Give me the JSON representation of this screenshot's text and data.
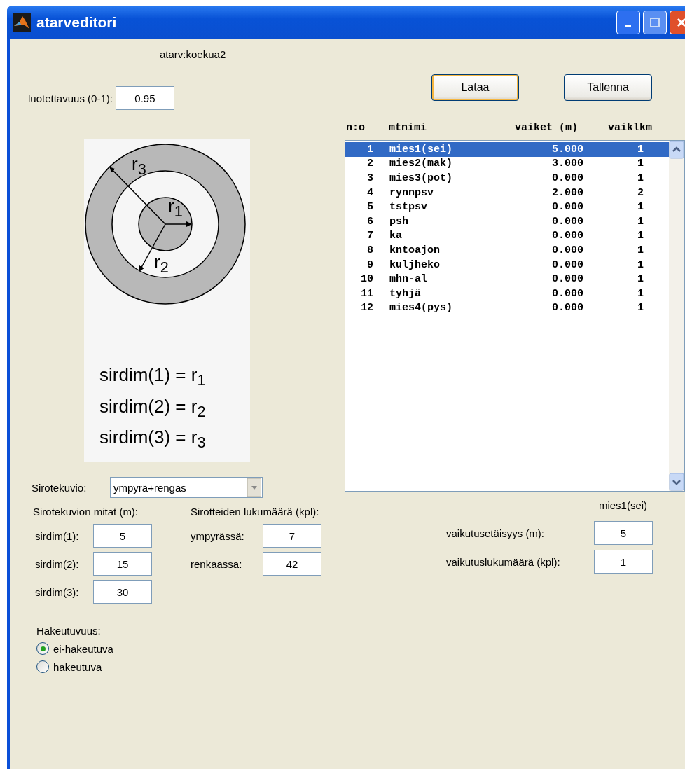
{
  "window": {
    "title": "atarveditori"
  },
  "file_label": "atarv:koekua2",
  "buttons": [
    {
      "label": "Lataa",
      "focused": true
    },
    {
      "label": "Tallenna",
      "focused": false
    }
  ],
  "reliability": {
    "label": "luotettavuus (0-1):",
    "value": "0.95"
  },
  "diagram": {
    "radius_labels": [
      "r$_{3}$",
      "r$_{1}$",
      "r$_{2}$"
    ],
    "equations": [
      "sirdim(1) = r$_{1}$",
      "sirdim(2) = r$_{2}$",
      "sirdim(3) = r$_{3}$"
    ]
  },
  "list": {
    "columns": [
      "n:o",
      "mtnimi",
      "vaiket (m)",
      "vaiklkm"
    ],
    "rows": [
      {
        "cells": [
          "1",
          "mies1(sei)",
          "5.000",
          "1"
        ],
        "selected": true
      },
      {
        "cells": [
          "2",
          "mies2(mak)",
          "3.000",
          "1"
        ],
        "selected": false
      },
      {
        "cells": [
          "3",
          "mies3(pot)",
          "0.000",
          "1"
        ],
        "selected": false
      },
      {
        "cells": [
          "4",
          "rynnpsv",
          "2.000",
          "2"
        ],
        "selected": false
      },
      {
        "cells": [
          "5",
          "tstpsv",
          "0.000",
          "1"
        ],
        "selected": false
      },
      {
        "cells": [
          "6",
          "psh",
          "0.000",
          "1"
        ],
        "selected": false
      },
      {
        "cells": [
          "7",
          "ka",
          "0.000",
          "1"
        ],
        "selected": false
      },
      {
        "cells": [
          "8",
          "kntoajon",
          "0.000",
          "1"
        ],
        "selected": false
      },
      {
        "cells": [
          "9",
          "kuljheko",
          "0.000",
          "1"
        ],
        "selected": false
      },
      {
        "cells": [
          "10",
          "mhn-al",
          "0.000",
          "1"
        ],
        "selected": false
      },
      {
        "cells": [
          "11",
          "tyhjä",
          "0.000",
          "1"
        ],
        "selected": false
      },
      {
        "cells": [
          "12",
          "mies4(pys)",
          "0.000",
          "1"
        ],
        "selected": false
      }
    ]
  },
  "pattern": {
    "label": "Sirotekuvio:",
    "value": "ympyrä+rengas"
  },
  "dimensions": {
    "title": "Sirotekuvion mitat (m):",
    "fields": [
      {
        "label": "sirdim(1):",
        "value": "5"
      },
      {
        "label": "sirdim(2):",
        "value": "15"
      },
      {
        "label": "sirdim(3):",
        "value": "30"
      }
    ]
  },
  "counts": {
    "title": "Sirotteiden lukumäärä (kpl):",
    "fields": [
      {
        "label": "ympyrässä:",
        "value": "7"
      },
      {
        "label": "renkaassa:",
        "value": "42"
      }
    ]
  },
  "effect": {
    "title": "mies1(sei)",
    "fields": [
      {
        "label": "vaikutusetäisyys (m):",
        "value": "5"
      },
      {
        "label": "vaikutuslukumäärä (kpl):",
        "value": "1"
      }
    ]
  },
  "homing": {
    "title": "Hakeutuvuus:",
    "options": [
      {
        "label": "ei-hakeutuva",
        "selected": true
      },
      {
        "label": "hakeutuva",
        "selected": false
      }
    ]
  }
}
